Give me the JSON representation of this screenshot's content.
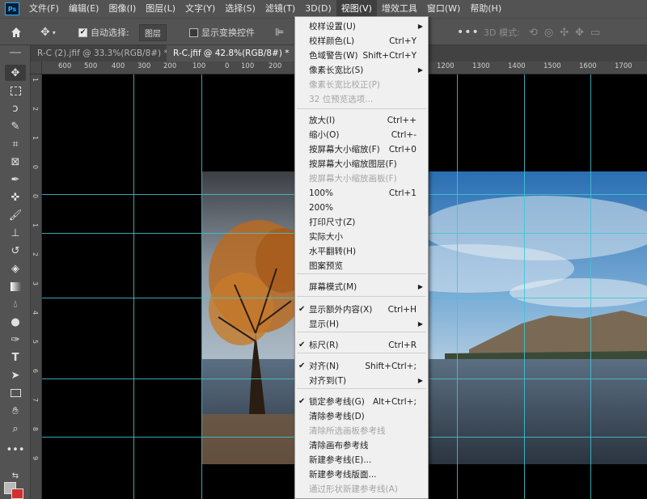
{
  "menubar": {
    "logo": "Ps",
    "items": [
      "文件(F)",
      "编辑(E)",
      "图像(I)",
      "图层(L)",
      "文字(Y)",
      "选择(S)",
      "滤镜(T)",
      "3D(D)",
      "视图(V)",
      "增效工具",
      "窗口(W)",
      "帮助(H)"
    ],
    "active": "视图(V)"
  },
  "options": {
    "auto_select_label": "自动选择:",
    "auto_select_value": "图层",
    "show_transform_label": "显示变换控件",
    "mode_3d_label": "3D 模式:"
  },
  "tabs": [
    {
      "label": "R-C (2).jfif @ 33.3%(RGB/8#) *",
      "close": "×"
    },
    {
      "label": "R-C.jfif @ 42.8%(RGB/8#) *",
      "close": "×"
    }
  ],
  "ruler_top": [
    "600",
    "500",
    "400",
    "300",
    "200",
    "100",
    "0",
    "100",
    "200",
    "1200",
    "1300",
    "1400",
    "1500",
    "1600",
    "1700"
  ],
  "ruler_left": [
    "1",
    "2",
    "1",
    "0",
    "0",
    "1",
    "2",
    "3",
    "4",
    "5",
    "6",
    "7",
    "8",
    "9"
  ],
  "view_menu": {
    "items": [
      {
        "label": "校样设置(U)",
        "shortcut": "",
        "arrow": "▶",
        "check": "",
        "disabled": false
      },
      {
        "label": "校样颜色(L)",
        "shortcut": "Ctrl+Y",
        "arrow": "",
        "check": "",
        "disabled": false
      },
      {
        "label": "色域警告(W)",
        "shortcut": "Shift+Ctrl+Y",
        "arrow": "",
        "check": "",
        "disabled": false
      },
      {
        "label": "像素长宽比(S)",
        "shortcut": "",
        "arrow": "▶",
        "check": "",
        "disabled": false
      },
      {
        "label": "像素长宽比校正(P)",
        "shortcut": "",
        "arrow": "",
        "check": "",
        "disabled": true
      },
      {
        "label": "32 位预览选项...",
        "shortcut": "",
        "arrow": "",
        "check": "",
        "disabled": true
      },
      {
        "label": "放大(I)",
        "shortcut": "Ctrl++",
        "arrow": "",
        "check": "",
        "disabled": false
      },
      {
        "label": "缩小(O)",
        "shortcut": "Ctrl+-",
        "arrow": "",
        "check": "",
        "disabled": false
      },
      {
        "label": "按屏幕大小缩放(F)",
        "shortcut": "Ctrl+0",
        "arrow": "",
        "check": "",
        "disabled": false
      },
      {
        "label": "按屏幕大小缩放图层(F)",
        "shortcut": "",
        "arrow": "",
        "check": "",
        "disabled": false
      },
      {
        "label": "按屏幕大小缩放画板(F)",
        "shortcut": "",
        "arrow": "",
        "check": "",
        "disabled": true
      },
      {
        "label": "100%",
        "shortcut": "Ctrl+1",
        "arrow": "",
        "check": "",
        "disabled": false
      },
      {
        "label": "200%",
        "shortcut": "",
        "arrow": "",
        "check": "",
        "disabled": false
      },
      {
        "label": "打印尺寸(Z)",
        "shortcut": "",
        "arrow": "",
        "check": "",
        "disabled": false
      },
      {
        "label": "实际大小",
        "shortcut": "",
        "arrow": "",
        "check": "",
        "disabled": false
      },
      {
        "label": "水平翻转(H)",
        "shortcut": "",
        "arrow": "",
        "check": "",
        "disabled": false
      },
      {
        "label": "图案预览",
        "shortcut": "",
        "arrow": "",
        "check": "",
        "disabled": false
      },
      {
        "label": "屏幕模式(M)",
        "shortcut": "",
        "arrow": "▶",
        "check": "",
        "disabled": false
      },
      {
        "label": "显示额外内容(X)",
        "shortcut": "Ctrl+H",
        "arrow": "",
        "check": "✔",
        "disabled": false
      },
      {
        "label": "显示(H)",
        "shortcut": "",
        "arrow": "▶",
        "check": "",
        "disabled": false
      },
      {
        "label": "标尺(R)",
        "shortcut": "Ctrl+R",
        "arrow": "",
        "check": "✔",
        "disabled": false
      },
      {
        "label": "对齐(N)",
        "shortcut": "Shift+Ctrl+;",
        "arrow": "",
        "check": "✔",
        "disabled": false
      },
      {
        "label": "对齐到(T)",
        "shortcut": "",
        "arrow": "▶",
        "check": "",
        "disabled": false
      },
      {
        "label": "锁定参考线(G)",
        "shortcut": "Alt+Ctrl+;",
        "arrow": "",
        "check": "✔",
        "disabled": false
      },
      {
        "label": "清除参考线(D)",
        "shortcut": "",
        "arrow": "",
        "check": "",
        "disabled": false
      },
      {
        "label": "清除所选画板参考线",
        "shortcut": "",
        "arrow": "",
        "check": "",
        "disabled": true
      },
      {
        "label": "清除画布参考线",
        "shortcut": "",
        "arrow": "",
        "check": "",
        "disabled": false
      },
      {
        "label": "新建参考线(E)...",
        "shortcut": "",
        "arrow": "",
        "check": "",
        "disabled": false
      },
      {
        "label": "新建参考线版面...",
        "shortcut": "",
        "arrow": "",
        "check": "",
        "disabled": false
      },
      {
        "label": "通过形状新建参考线(A)",
        "shortcut": "",
        "arrow": "",
        "check": "",
        "disabled": true
      }
    ]
  },
  "tools": [
    "move-tool-icon",
    "marquee-tool-icon",
    "lasso-tool-icon",
    "quick-select-tool-icon",
    "crop-tool-icon",
    "frame-tool-icon",
    "eyedropper-tool-icon",
    "healing-brush-tool-icon",
    "brush-tool-icon",
    "clone-stamp-tool-icon",
    "history-brush-tool-icon",
    "eraser-tool-icon",
    "gradient-tool-icon",
    "blur-tool-icon",
    "dodge-tool-icon",
    "pen-tool-icon",
    "type-tool-icon",
    "path-select-tool-icon",
    "rectangle-tool-icon",
    "hand-tool-icon",
    "zoom-tool-icon",
    "more-tools-icon"
  ],
  "colors": {
    "guide": "#3fc6d4",
    "ui_panel": "#535353",
    "menu_bg": "#f0f0f0",
    "bg_swatch": "#d32f2f"
  }
}
